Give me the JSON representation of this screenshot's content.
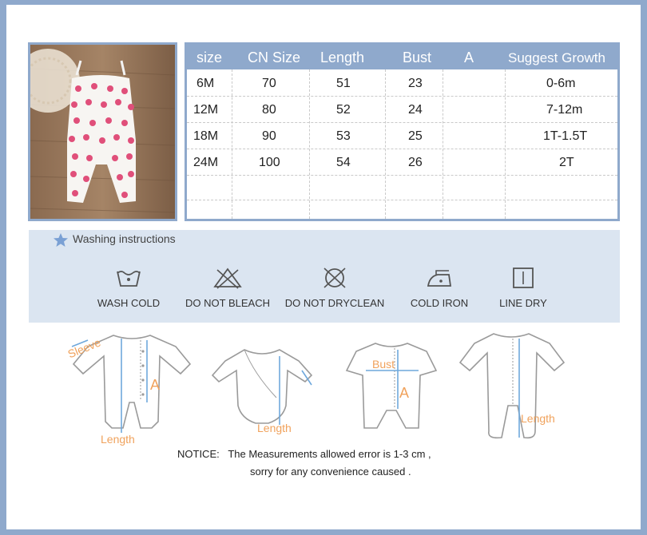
{
  "size_table": {
    "headers": [
      "size",
      "CN Size",
      "Length",
      "Bust",
      "A",
      "Suggest Growth"
    ],
    "rows": [
      [
        "6M",
        "70",
        "51",
        "23",
        "",
        "0-6m"
      ],
      [
        "12M",
        "80",
        "52",
        "24",
        "",
        "7-12m"
      ],
      [
        "18M",
        "90",
        "53",
        "25",
        "",
        "1T-1.5T"
      ],
      [
        "24M",
        "100",
        "54",
        "26",
        "",
        "2T"
      ]
    ]
  },
  "washing": {
    "title": "Washing instructions",
    "items": [
      {
        "label": "WASH COLD",
        "icon": "wash-cold-icon"
      },
      {
        "label": "DO NOT BLEACH",
        "icon": "no-bleach-icon"
      },
      {
        "label": "DO NOT DRYCLEAN",
        "icon": "no-dryclean-icon"
      },
      {
        "label": "COLD IRON",
        "icon": "cold-iron-icon"
      },
      {
        "label": "LINE DRY",
        "icon": "line-dry-icon"
      }
    ]
  },
  "diagrams": {
    "romper_long": {
      "sleeve": "Sleeve",
      "a": "A",
      "length": "Length"
    },
    "bodysuit": {
      "length": "Length"
    },
    "romper_short": {
      "bust": "Bust",
      "a": "A"
    },
    "footed": {
      "length": "Length"
    }
  },
  "notice": {
    "line1": "NOTICE:   The Measurements allowed error is 1-3 cm ,",
    "line2": "sorry for any convenience caused ."
  },
  "colors": {
    "accent": "#8fa9cc",
    "wash_bg": "#dbe5f1",
    "measure_orange": "#f0a25c",
    "measure_blue": "#6fa8dc"
  }
}
